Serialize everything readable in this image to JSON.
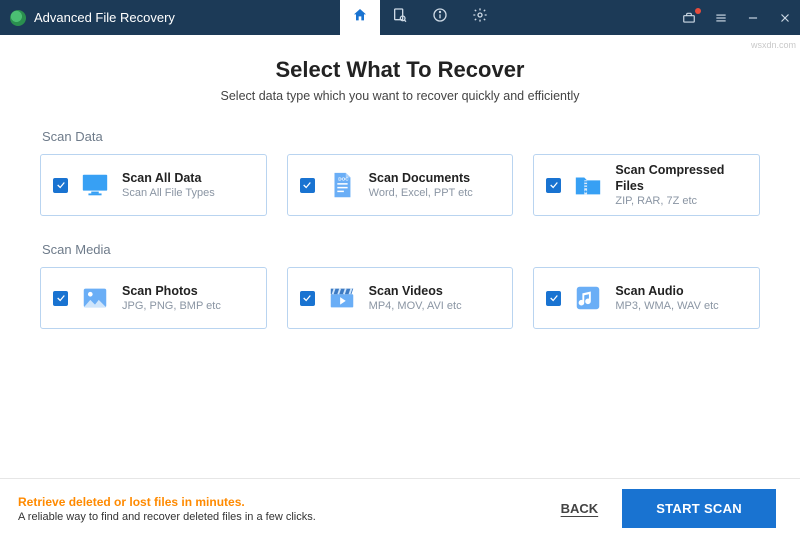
{
  "app": {
    "title": "Advanced File Recovery"
  },
  "heading": {
    "title": "Select What To Recover",
    "subtitle": "Select data type which you want to recover quickly and efficiently"
  },
  "sections": {
    "data_label": "Scan Data",
    "media_label": "Scan Media"
  },
  "cards": {
    "all": {
      "title": "Scan All Data",
      "subtitle": "Scan All File Types"
    },
    "docs": {
      "title": "Scan Documents",
      "subtitle": "Word, Excel, PPT etc"
    },
    "zip": {
      "title": "Scan Compressed Files",
      "subtitle": "ZIP, RAR, 7Z etc"
    },
    "photo": {
      "title": "Scan Photos",
      "subtitle": "JPG, PNG, BMP etc"
    },
    "video": {
      "title": "Scan Videos",
      "subtitle": "MP4, MOV, AVI etc"
    },
    "audio": {
      "title": "Scan Audio",
      "subtitle": "MP3, WMA, WAV etc"
    }
  },
  "footer": {
    "promo_title": "Retrieve deleted or lost files in minutes.",
    "promo_sub": "A reliable way to find and recover deleted files in a few clicks.",
    "back": "BACK",
    "start": "START SCAN"
  },
  "watermark": "wsxdn.com"
}
